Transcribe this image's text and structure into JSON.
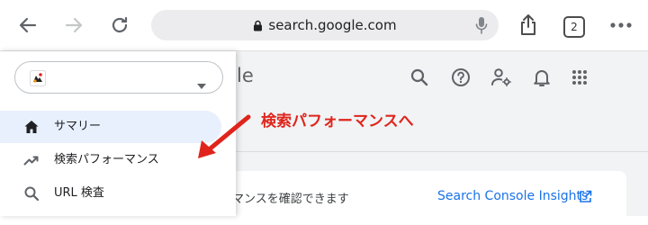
{
  "browser": {
    "url": "search.google.com",
    "tab_count": "2"
  },
  "header": {
    "title_fragment": "le"
  },
  "property_selector": {
    "value": ""
  },
  "sidebar": {
    "items": [
      {
        "label": "サマリー",
        "icon": "home-icon",
        "active": true
      },
      {
        "label": "検索パフォーマンス",
        "icon": "trending-up-icon",
        "active": false
      },
      {
        "label": "URL 検査",
        "icon": "search-icon",
        "active": false
      }
    ]
  },
  "card": {
    "text_fragment": "マンスを確認できます",
    "link_label": "Search Console Insights"
  },
  "annotation": {
    "text": "検索パフォーマンスへ",
    "color": "#e0241c"
  },
  "colors": {
    "accent": "#1a73e8",
    "active_item_bg": "#e8f0fe"
  }
}
